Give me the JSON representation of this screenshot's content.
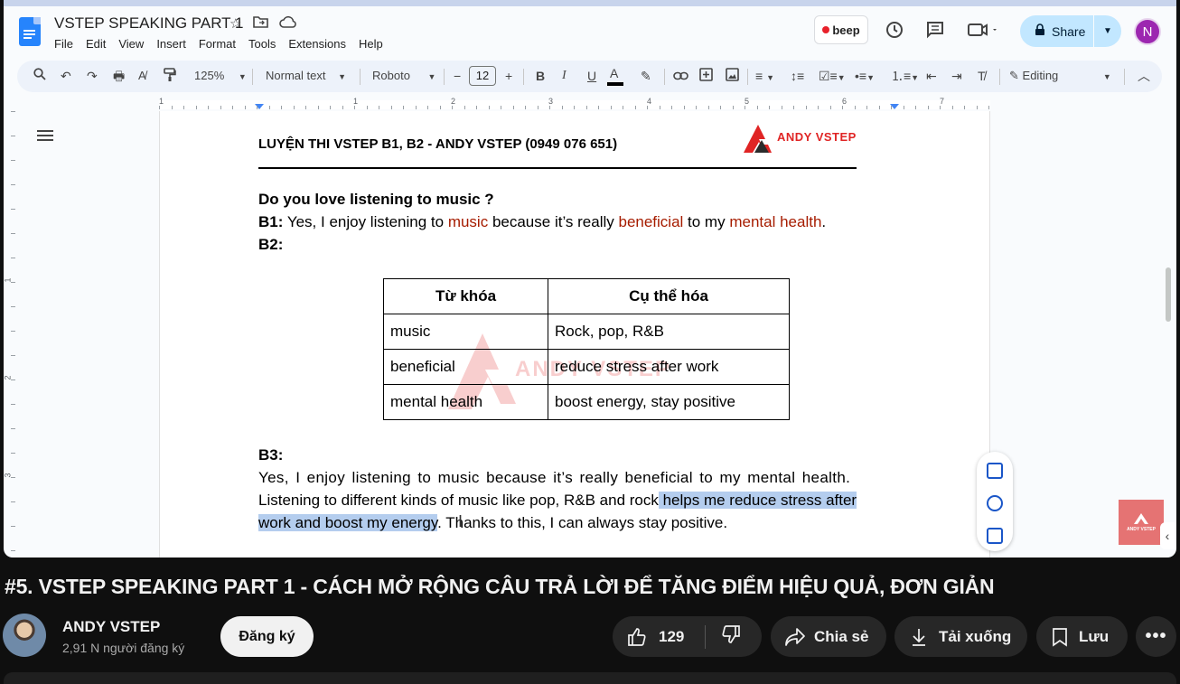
{
  "docs": {
    "title": "VSTEP SPEAKING PART 1",
    "menu": [
      "File",
      "Edit",
      "View",
      "Insert",
      "Format",
      "Tools",
      "Extensions",
      "Help"
    ],
    "beep_label": "beep",
    "share_label": "Share",
    "user_initial": "N",
    "toolbar": {
      "zoom": "125%",
      "style": "Normal text",
      "font": "Roboto",
      "font_size": "12",
      "mode": "Editing"
    },
    "ruler_numbers": [
      "1",
      "1",
      "2",
      "3",
      "4",
      "5",
      "6",
      "7"
    ],
    "vruler_numbers": [
      "1",
      "2",
      "3"
    ]
  },
  "document": {
    "header": "LUYỆN THI VSTEP B1, B2 - ANDY VSTEP (0949 076 651)",
    "logo_text": "ANDY VSTEP",
    "question": "Do you love listening to music ?",
    "b1_label": "B1:",
    "b1_parts": [
      " Yes, I enjoy listening to ",
      "music",
      " because it’s really ",
      "beneficial",
      " to my ",
      "mental health",
      "."
    ],
    "b2_label": "B2:",
    "table": {
      "headers": [
        "Từ khóa",
        "Cụ thể hóa"
      ],
      "rows": [
        [
          "music",
          "Rock, pop, R&B"
        ],
        [
          "beneficial",
          "reduce stress after work"
        ],
        [
          "mental health",
          "boost energy, stay positive"
        ]
      ]
    },
    "watermark_text": "ANDY VSTEP",
    "b3_label": "B3:",
    "b3_line1": "Yes, I enjoy listening to music because it’s really beneficial to my mental health.",
    "b3_line2_plain": "Listening to different kinds of music like pop, R&B and rock",
    "b3_line2_hl": " helps me reduce stress after",
    "b3_line3_hl": "work and boost my energy",
    "b3_line3_plain": ". Thanks to this, I can always stay positive."
  },
  "corner_logo_text": "ANDY VSTEP",
  "youtube": {
    "video_title": "#5. VSTEP SPEAKING PART 1 - CÁCH MỞ RỘNG CÂU TRẢ LỜI ĐỂ TĂNG ĐIỂM HIỆU QUẢ, ĐƠN GIẢN",
    "channel_name": "ANDY VSTEP",
    "subscribers": "2,91 N người đăng ký",
    "subscribe_label": "Đăng ký",
    "likes": "129",
    "share_label": "Chia sẻ",
    "download_label": "Tải xuống",
    "save_label": "Lưu"
  },
  "colors": {
    "docs_accent": "#2684fc",
    "share_bg": "#c2e7ff",
    "keyword_red": "#a61c00",
    "highlight": "#b4cdee",
    "logo_red": "#e02424"
  }
}
